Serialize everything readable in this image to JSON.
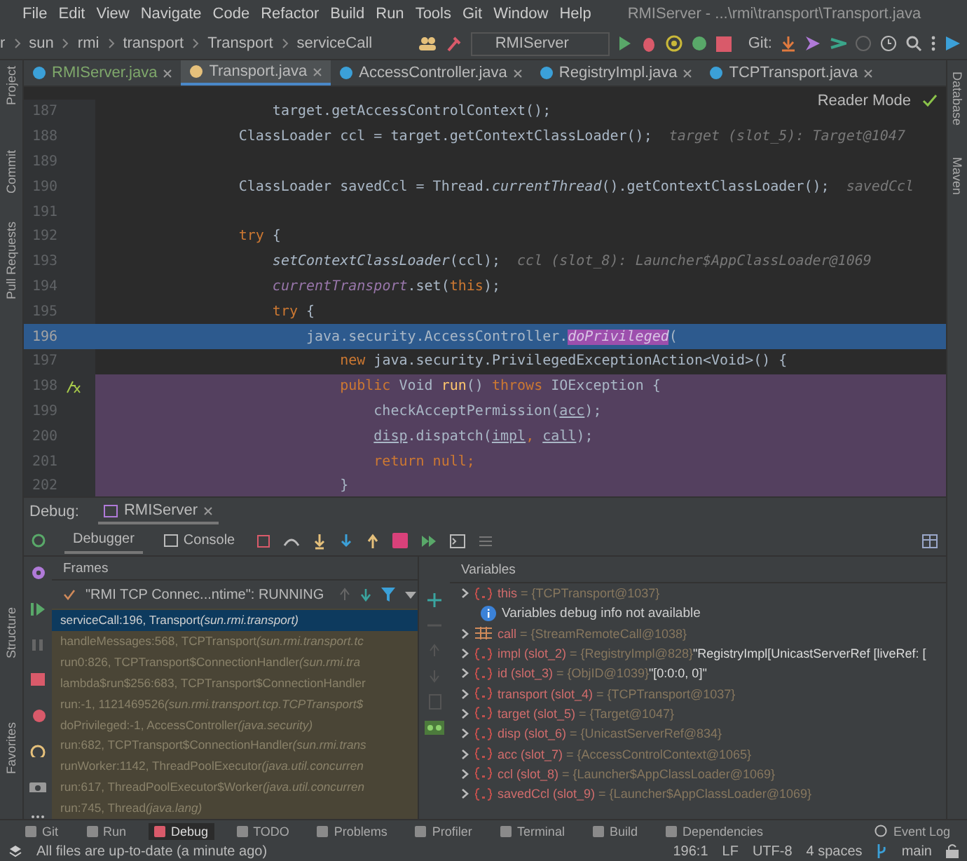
{
  "menu": [
    "File",
    "Edit",
    "View",
    "Navigate",
    "Code",
    "Refactor",
    "Build",
    "Run",
    "Tools",
    "Git",
    "Window",
    "Help"
  ],
  "window": {
    "title": "RMIServer - ...\\rmi\\transport\\Transport.java"
  },
  "breadcrumb": [
    "r",
    "sun",
    "rmi",
    "transport",
    "Transport",
    "serviceCall"
  ],
  "run_config": "RMIServer",
  "git_label": "Git:",
  "left_strip": [
    "Project",
    "Commit",
    "Pull Requests",
    "Structure",
    "Favorites"
  ],
  "right_strip": [
    "Database",
    "Maven"
  ],
  "tabs": [
    {
      "label": "RMIServer.java",
      "selected": false
    },
    {
      "label": "Transport.java",
      "selected": true
    },
    {
      "label": "AccessController.java",
      "selected": false
    },
    {
      "label": "RegistryImpl.java",
      "selected": false
    },
    {
      "label": "TCPTransport.java",
      "selected": false
    }
  ],
  "reader_mode": "Reader Mode",
  "code_lines": [
    {
      "number": "187",
      "exec": false,
      "lambda": false,
      "tokens": [
        {
          "text": "                    target.getAccessControlContext();",
          "kind": "plain"
        }
      ]
    },
    {
      "number": "188",
      "exec": false,
      "lambda": false,
      "tokens": [
        {
          "text": "                ClassLoader ccl = target.getContextClassLoader();",
          "kind": "plain"
        },
        {
          "text": "  target (slot_5): Target@1047",
          "kind": "hint"
        }
      ]
    },
    {
      "number": "189",
      "exec": false,
      "lambda": false
    },
    {
      "number": "190",
      "exec": false,
      "lambda": false,
      "tokens": [
        {
          "text": "                ClassLoader savedCcl = Thread.",
          "kind": "plain"
        },
        {
          "text": "currentThread",
          "kind": "italic"
        },
        {
          "text": "().getContextClassLoader();",
          "kind": "plain"
        },
        {
          "text": "  savedCcl",
          "kind": "hint"
        }
      ]
    },
    {
      "number": "191",
      "exec": false,
      "lambda": false
    },
    {
      "number": "192",
      "exec": false,
      "lambda": false,
      "tokens": [
        {
          "text": "                try",
          "kind": "kw"
        },
        {
          "text": " {",
          "kind": "plain"
        }
      ]
    },
    {
      "number": "193",
      "exec": false,
      "lambda": false,
      "tokens": [
        {
          "text": "                    setContextClassLoader",
          "kind": "italic"
        },
        {
          "text": "(ccl);",
          "kind": "plain"
        },
        {
          "text": "  ccl (slot_8): Launcher$AppClassLoader@1069",
          "kind": "hint"
        }
      ]
    },
    {
      "number": "194",
      "exec": false,
      "lambda": false,
      "tokens": [
        {
          "text": "                    currentTransport",
          "kind": "field"
        },
        {
          "text": ".set(",
          "kind": "plain"
        },
        {
          "text": "this",
          "kind": "kw"
        },
        {
          "text": ");",
          "kind": "plain"
        }
      ]
    },
    {
      "number": "195",
      "exec": false,
      "lambda": false,
      "tokens": [
        {
          "text": "                    try",
          "kind": "kw"
        },
        {
          "text": " {",
          "kind": "plain"
        }
      ]
    },
    {
      "number": "196",
      "exec": true,
      "lambda": false,
      "tokens": [
        {
          "text": "                        java.security.AccessController.",
          "kind": "plain"
        },
        {
          "text": "doPrivileged",
          "kind": "call"
        },
        {
          "text": "(",
          "kind": "plain"
        }
      ]
    },
    {
      "number": "197",
      "exec": false,
      "lambda": false,
      "tokens": [
        {
          "text": "                            new",
          "kind": "kw"
        },
        {
          "text": " java.security.PrivilegedExceptionAction<Void>() {",
          "kind": "plain"
        }
      ]
    },
    {
      "number": "198",
      "exec": false,
      "lambda": true,
      "lambda_marker": true,
      "tokens": [
        {
          "text": "                            public",
          "kind": "kw"
        },
        {
          "text": " Void ",
          "kind": "plain"
        },
        {
          "text": "run",
          "kind": "method"
        },
        {
          "text": "() ",
          "kind": "plain"
        },
        {
          "text": "throws",
          "kind": "kw"
        },
        {
          "text": " IOException {",
          "kind": "plain"
        }
      ]
    },
    {
      "number": "199",
      "exec": false,
      "lambda": true,
      "tokens": [
        {
          "text": "                                checkAcceptPermission(",
          "kind": "plain"
        },
        {
          "text": "acc",
          "kind": "underline"
        },
        {
          "text": ");",
          "kind": "plain"
        }
      ]
    },
    {
      "number": "200",
      "exec": false,
      "lambda": true,
      "tokens": [
        {
          "text": "                                disp",
          "kind": "underline"
        },
        {
          "text": ".dispatch(",
          "kind": "plain"
        },
        {
          "text": "impl",
          "kind": "underline"
        },
        {
          "text": ", ",
          "kind": "kw"
        },
        {
          "text": "call",
          "kind": "underline"
        },
        {
          "text": ");",
          "kind": "plain"
        }
      ]
    },
    {
      "number": "201",
      "exec": false,
      "lambda": true,
      "tokens": [
        {
          "text": "                                return null",
          "kind": "kw"
        },
        {
          "text": ";",
          "kind": "kw"
        }
      ]
    },
    {
      "number": "202",
      "exec": false,
      "lambda": true,
      "tokens": [
        {
          "text": "                            }",
          "kind": "plain"
        }
      ]
    }
  ],
  "debug": {
    "label": "Debug:",
    "session": "RMIServer",
    "tabs": [
      {
        "label": "Debugger",
        "selected": true
      },
      {
        "label": "Console",
        "selected": false
      }
    ],
    "frames_title": "Frames",
    "thread": "\"RMI TCP Connec...ntime\": RUNNING",
    "frames": [
      {
        "location": "serviceCall:196, Transport",
        "package": "(sun.rmi.transport)",
        "selected": true
      },
      {
        "location": "handleMessages:568, TCPTransport",
        "package": "(sun.rmi.transport.tc",
        "selected": false
      },
      {
        "location": "run0:826, TCPTransport$ConnectionHandler",
        "package": "(sun.rmi.tra",
        "selected": false
      },
      {
        "location": "lambda$run$256:683, TCPTransport$ConnectionHandler",
        "selected": false
      },
      {
        "location": "run:-1, 1121469526",
        "package": "(sun.rmi.transport.tcp.TCPTransport$",
        "selected": false
      },
      {
        "location": "doPrivileged:-1, AccessController",
        "package": "(java.security)",
        "selected": false
      },
      {
        "location": "run:682, TCPTransport$ConnectionHandler",
        "package": "(sun.rmi.trans",
        "selected": false
      },
      {
        "location": "runWorker:1142, ThreadPoolExecutor",
        "package": "(java.util.concurren",
        "selected": false
      },
      {
        "location": "run:617, ThreadPoolExecutor$Worker",
        "package": "(java.util.concurren",
        "selected": false
      },
      {
        "location": "run:745, Thread",
        "package": "(java.lang)",
        "selected": false
      }
    ],
    "variables_title": "Variables",
    "variables": [
      {
        "kind": "object",
        "name": "this",
        "value": "= {TCPTransport@1037}"
      },
      {
        "kind": "info",
        "name": "Variables debug info not available"
      },
      {
        "kind": "fields",
        "name": "call",
        "value": "= {StreamRemoteCall@1038}"
      },
      {
        "kind": "object",
        "name": "impl (slot_2)",
        "value": "= {RegistryImpl@828}",
        "detail": "\"RegistryImpl[UnicastServerRef [liveRef: ["
      },
      {
        "kind": "object",
        "name": "id (slot_3)",
        "value": "= {ObjID@1039}",
        "detail": "\"[0:0:0, 0]\""
      },
      {
        "kind": "object",
        "name": "transport (slot_4)",
        "value": "= {TCPTransport@1037}"
      },
      {
        "kind": "object",
        "name": "target (slot_5)",
        "value": "= {Target@1047}"
      },
      {
        "kind": "object",
        "name": "disp (slot_6)",
        "value": "= {UnicastServerRef@834}"
      },
      {
        "kind": "object",
        "name": "acc (slot_7)",
        "value": "= {AccessControlContext@1065}"
      },
      {
        "kind": "object",
        "name": "ccl (slot_8)",
        "value": "= {Launcher$AppClassLoader@1069}"
      },
      {
        "kind": "object",
        "name": "savedCcl (slot_9)",
        "value": "= {Launcher$AppClassLoader@1069}"
      }
    ]
  },
  "tool_windows": [
    {
      "label": "Git",
      "selected": false
    },
    {
      "label": "Run",
      "selected": false
    },
    {
      "label": "Debug",
      "selected": true
    },
    {
      "label": "TODO",
      "selected": false
    },
    {
      "label": "Problems",
      "selected": false
    },
    {
      "label": "Profiler",
      "selected": false
    },
    {
      "label": "Terminal",
      "selected": false
    },
    {
      "label": "Build",
      "selected": false
    },
    {
      "label": "Dependencies",
      "selected": false
    }
  ],
  "event_log": "Event Log",
  "status": {
    "message": "All files are up-to-date (a minute ago)",
    "position": "196:1",
    "line_sep": "LF",
    "encoding": "UTF-8",
    "indent": "4 spaces",
    "branch": "main"
  }
}
